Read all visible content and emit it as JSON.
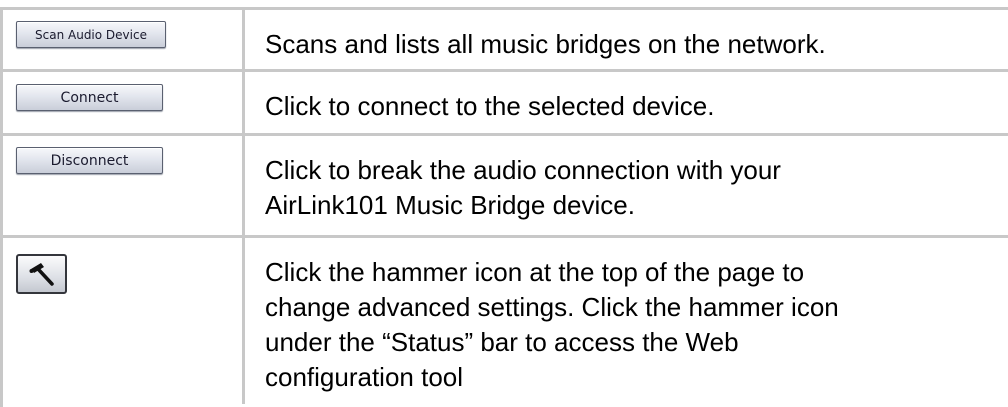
{
  "rows": [
    {
      "button_label": "Scan Audio Device",
      "description": "Scans and lists all music bridges on the network."
    },
    {
      "button_label": "Connect",
      "description": "Click to connect to the selected device."
    },
    {
      "button_label": "Disconnect",
      "description_line1": "Click to break the audio connection with your",
      "description_line2": "AirLink101 Music Bridge device."
    },
    {
      "icon": "hammer-icon",
      "description_line1": "Click the hammer icon at the top of the page to",
      "description_line2": "change advanced settings. Click the hammer icon",
      "description_line3": "under the “Status” bar to access the Web",
      "description_line4": "configuration tool"
    }
  ]
}
